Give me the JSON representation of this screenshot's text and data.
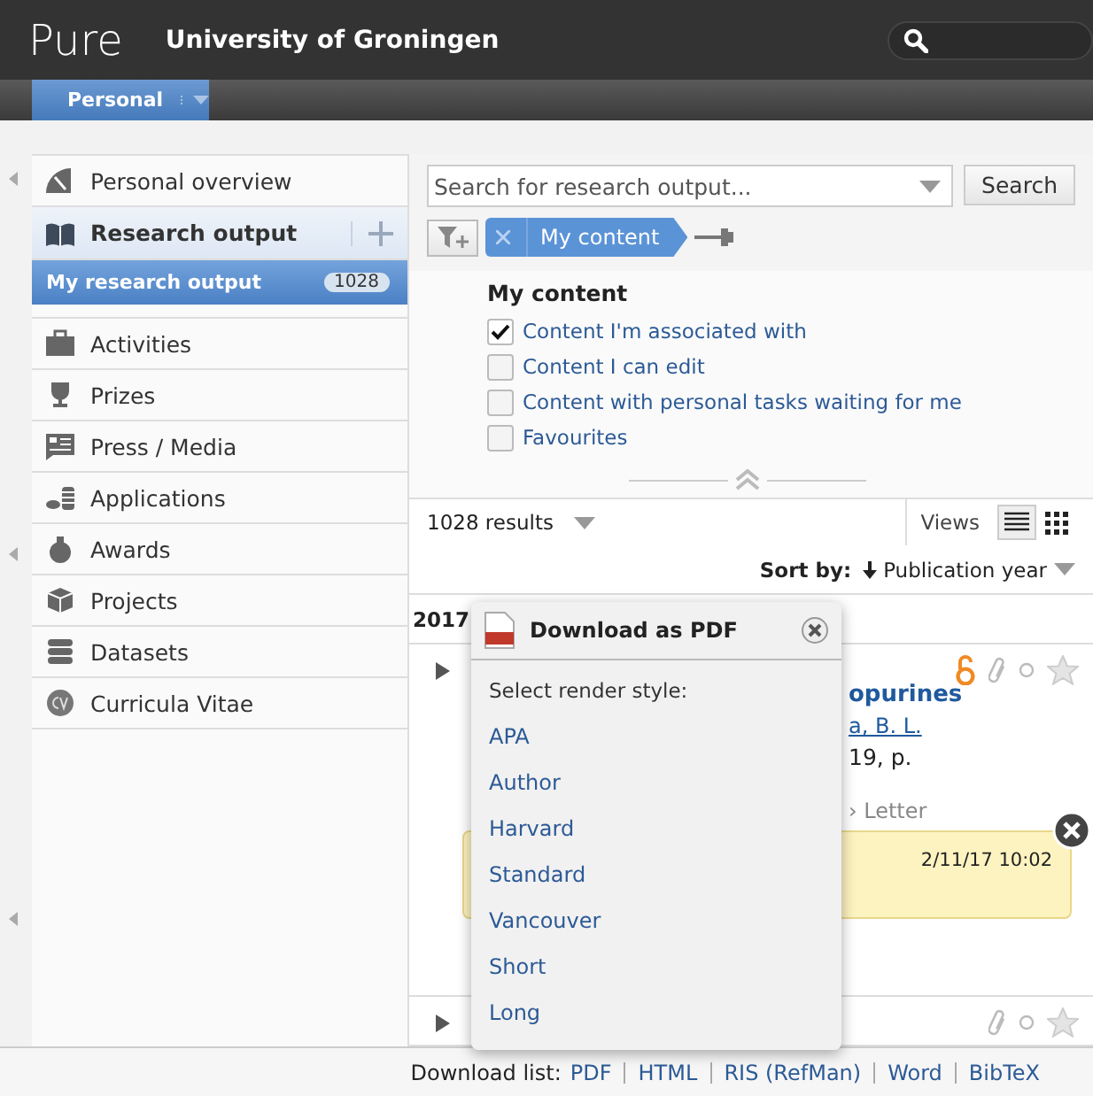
{
  "header": {
    "logo": "Pure",
    "institution": "University of Groningen"
  },
  "nav_tabs": [
    {
      "label": "Personal",
      "selected": true
    }
  ],
  "sidebar": {
    "items": [
      {
        "label": "Personal overview",
        "selected": false
      },
      {
        "label": "Research output",
        "selected": false,
        "expanded": true,
        "children": [
          {
            "label": "My research output",
            "count": "1028",
            "selected": true
          }
        ]
      },
      {
        "label": "Activities",
        "selected": false
      },
      {
        "label": "Prizes",
        "selected": false
      },
      {
        "label": "Press / Media",
        "selected": false
      },
      {
        "label": "Applications",
        "selected": false
      },
      {
        "label": "Awards",
        "selected": false
      },
      {
        "label": "Projects",
        "selected": false
      },
      {
        "label": "Datasets",
        "selected": false
      },
      {
        "label": "Curricula Vitae",
        "selected": false
      }
    ]
  },
  "search": {
    "placeholder": "Search for research output...",
    "button": "Search"
  },
  "filter_chip": {
    "label": "My content"
  },
  "filter_panel": {
    "title": "My content",
    "options": [
      {
        "label": "Content I'm associated with",
        "checked": true
      },
      {
        "label": "Content I can edit",
        "checked": false
      },
      {
        "label": "Content with personal tasks waiting for me",
        "checked": false
      },
      {
        "label": "Favourites",
        "checked": false
      }
    ]
  },
  "results_bar": {
    "count": "1028 results",
    "views_label": "Views",
    "views": [
      {
        "kind": "list",
        "selected": true
      },
      {
        "kind": "grid",
        "selected": false
      }
    ],
    "sort_label": "Sort by:",
    "sort_value": "Publication year"
  },
  "year": "2017",
  "results": [
    {
      "title": "opurines",
      "authors": "a, B. L.",
      "source": "19, p.",
      "type": "› Letter",
      "open_access": true,
      "note": {
        "timestamp": "2/11/17 10:02"
      }
    },
    {
      "open_access": false
    }
  ],
  "popup": {
    "title": "Download as PDF",
    "prompt": "Select render style:",
    "styles": [
      "APA",
      "Author",
      "Harvard",
      "Standard",
      "Vancouver",
      "Short",
      "Long"
    ]
  },
  "footer": {
    "label": "Download list:",
    "links": [
      "PDF",
      "HTML",
      "RIS (RefMan)",
      "Word",
      "BibTeX"
    ]
  }
}
